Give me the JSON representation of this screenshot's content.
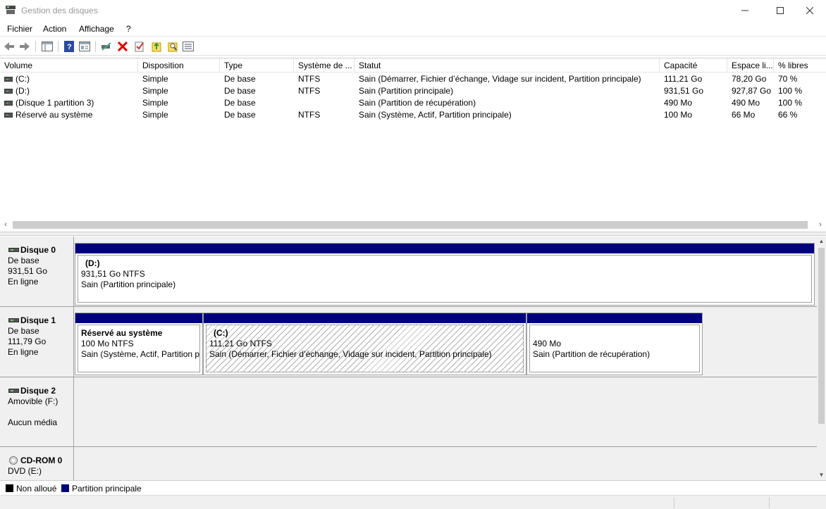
{
  "window": {
    "title": "Gestion des disques",
    "icons": {
      "app": "disk-management-icon",
      "minimize": "minimize-icon",
      "maximize": "maximize-icon",
      "close": "close-icon"
    }
  },
  "menu": [
    "Fichier",
    "Action",
    "Affichage",
    "?"
  ],
  "toolbar": {
    "buttons": [
      "back-icon",
      "forward-icon",
      "console-tree-icon",
      "help-icon",
      "properties-icon",
      "connect-disk-icon",
      "delete-icon",
      "check-icon",
      "export-icon",
      "search-icon",
      "list-icon"
    ]
  },
  "volumes": {
    "columns": [
      "Volume",
      "Disposition",
      "Type",
      "Système de ...",
      "Statut",
      "Capacité",
      "Espace li...",
      "% libres"
    ],
    "rows": [
      {
        "volume": "(C:)",
        "disposition": "Simple",
        "type": "De base",
        "fs": "NTFS",
        "status": "Sain (Démarrer, Fichier d’échange, Vidage sur incident, Partition principale)",
        "capacity": "111,21 Go",
        "free": "78,20 Go",
        "pct": "70 %"
      },
      {
        "volume": "(D:)",
        "disposition": "Simple",
        "type": "De base",
        "fs": "NTFS",
        "status": "Sain (Partition principale)",
        "capacity": "931,51 Go",
        "free": "927,87 Go",
        "pct": "100 %"
      },
      {
        "volume": "(Disque 1 partition 3)",
        "disposition": "Simple",
        "type": "De base",
        "fs": "",
        "status": "Sain (Partition de récupération)",
        "capacity": "490 Mo",
        "free": "490 Mo",
        "pct": "100 %"
      },
      {
        "volume": "Réservé au système",
        "disposition": "Simple",
        "type": "De base",
        "fs": "NTFS",
        "status": "Sain (Système, Actif, Partition principale)",
        "capacity": "100 Mo",
        "free": "66 Mo",
        "pct": "66 %"
      }
    ]
  },
  "disks": [
    {
      "name": "Disque 0",
      "line1": "De base",
      "line2": "931,51 Go",
      "line3": "En ligne",
      "partitions": [
        {
          "name": "(D:)",
          "size": "931,51 Go NTFS",
          "status": "Sain (Partition principale)"
        }
      ]
    },
    {
      "name": "Disque 1",
      "line1": "De base",
      "line2": "111,79 Go",
      "line3": "En ligne",
      "partitions": [
        {
          "name": "Réservé au système",
          "size": "100 Mo NTFS",
          "status": "Sain (Système, Actif, Partition p"
        },
        {
          "name": "(C:)",
          "size": "111,21 Go NTFS",
          "status": "Sain (Démarrer, Fichier d’échange, Vidage sur incident, Partition principale)"
        },
        {
          "name": "",
          "size": "490 Mo",
          "status": "Sain (Partition de récupération)"
        }
      ]
    },
    {
      "name": "Disque 2",
      "line1": "Amovible (F:)",
      "line2": "",
      "line3": "Aucun média"
    },
    {
      "name": "CD-ROM 0",
      "line1": "DVD (E:)"
    }
  ],
  "legend": [
    {
      "label": "Non alloué",
      "color": "#000000"
    },
    {
      "label": "Partition principale",
      "color": "#00007f"
    }
  ]
}
